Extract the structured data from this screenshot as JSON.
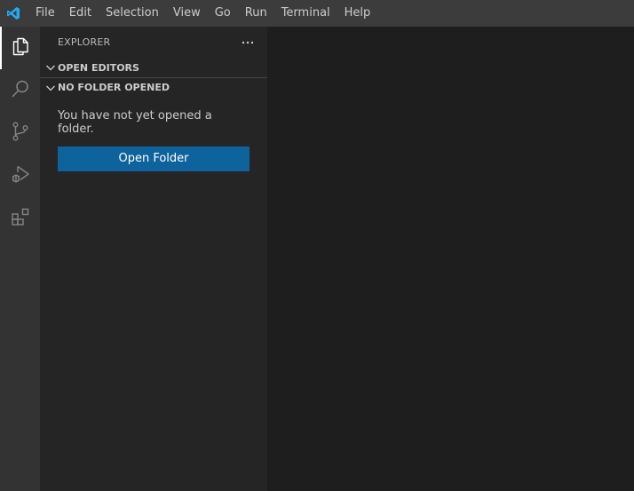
{
  "menu": {
    "items": [
      {
        "label": "File"
      },
      {
        "label": "Edit"
      },
      {
        "label": "Selection"
      },
      {
        "label": "View"
      },
      {
        "label": "Go"
      },
      {
        "label": "Run"
      },
      {
        "label": "Terminal"
      },
      {
        "label": "Help"
      }
    ]
  },
  "activity_bar": {
    "items": [
      {
        "icon": "files-icon",
        "active": true
      },
      {
        "icon": "search-icon",
        "active": false
      },
      {
        "icon": "source-control-icon",
        "active": false
      },
      {
        "icon": "run-debug-icon",
        "active": false
      },
      {
        "icon": "extensions-icon",
        "active": false
      }
    ]
  },
  "sidebar": {
    "title": "EXPLORER",
    "sections": [
      {
        "label": "OPEN EDITORS"
      },
      {
        "label": "NO FOLDER OPENED"
      }
    ],
    "empty_message": "You have not yet opened a folder.",
    "open_folder_label": "Open Folder"
  },
  "colors": {
    "titlebar": "#3c3c3c",
    "activitybar": "#333333",
    "sidebar": "#252526",
    "editor": "#1e1e1e",
    "button": "#0e639c",
    "logo": "#23a9f2"
  }
}
